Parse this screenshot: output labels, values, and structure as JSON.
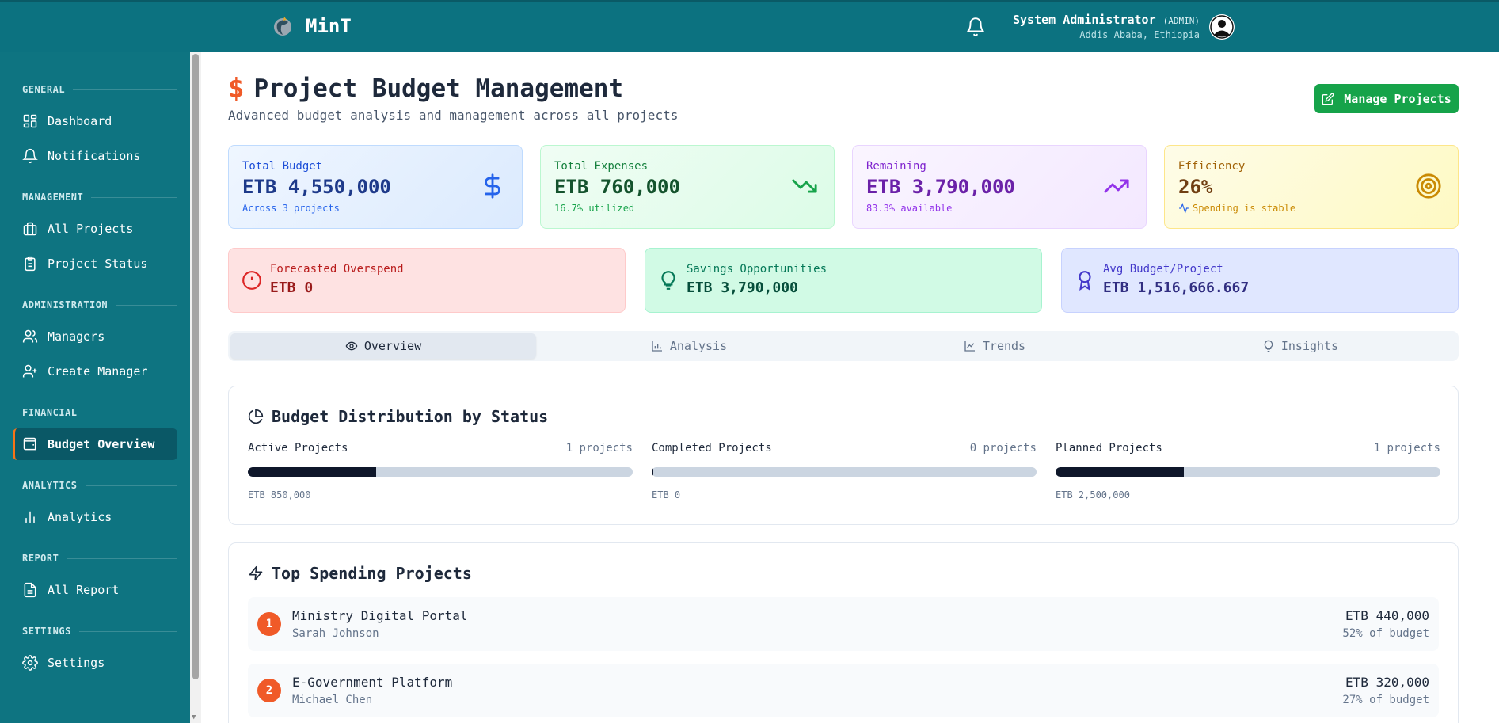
{
  "app": {
    "name": "MinT"
  },
  "header": {
    "user_name": "System Administrator",
    "user_role": "(ADMIN)",
    "user_location": "Addis Ababa, Ethiopia"
  },
  "sidebar": {
    "sections": [
      {
        "title": "GENERAL",
        "items": [
          {
            "label": "Dashboard",
            "icon": "dashboard-icon"
          },
          {
            "label": "Notifications",
            "icon": "bell-icon"
          }
        ]
      },
      {
        "title": "MANAGEMENT",
        "items": [
          {
            "label": "All Projects",
            "icon": "briefcase-icon"
          },
          {
            "label": "Project Status",
            "icon": "clipboard-icon"
          }
        ]
      },
      {
        "title": "ADMINISTRATION",
        "items": [
          {
            "label": "Managers",
            "icon": "users-icon"
          },
          {
            "label": "Create Manager",
            "icon": "user-plus-icon"
          }
        ]
      },
      {
        "title": "FINANCIAL",
        "items": [
          {
            "label": "Budget Overview",
            "icon": "wallet-icon",
            "active": true
          }
        ]
      },
      {
        "title": "ANALYTICS",
        "items": [
          {
            "label": "Analytics",
            "icon": "bar-chart-icon"
          }
        ]
      },
      {
        "title": "REPORT",
        "items": [
          {
            "label": "All Report",
            "icon": "file-icon"
          }
        ]
      },
      {
        "title": "SETTINGS",
        "items": [
          {
            "label": "Settings",
            "icon": "gear-icon"
          }
        ]
      }
    ]
  },
  "page": {
    "title": "Project Budget Management",
    "subtitle": "Advanced budget analysis and management across all projects",
    "manage_button": "Manage Projects"
  },
  "stats": [
    {
      "label": "Total Budget",
      "value": "ETB 4,550,000",
      "sub": "Across 3 projects",
      "icon": "dollar-icon",
      "color": "#1d4ed8"
    },
    {
      "label": "Total Expenses",
      "value": "ETB 760,000",
      "sub": "16.7% utilized",
      "icon": "trending-down-icon",
      "color": "#15803d"
    },
    {
      "label": "Remaining",
      "value": "ETB 3,790,000",
      "sub": "83.3% available",
      "icon": "trending-up-icon",
      "color": "#7e22ce"
    },
    {
      "label": "Efficiency",
      "value": "26%",
      "sub": "Spending is stable",
      "icon": "target-icon",
      "color": "#a16207"
    }
  ],
  "stats2": [
    {
      "label": "Forecasted Overspend",
      "value": "ETB 0",
      "icon": "alert-circle-icon",
      "color": "#dc2626"
    },
    {
      "label": "Savings Opportunities",
      "value": "ETB 3,790,000",
      "icon": "lightbulb-icon",
      "color": "#047857"
    },
    {
      "label": "Avg Budget/Project",
      "value": "ETB 1,516,666.667",
      "icon": "award-icon",
      "color": "#4338ca"
    }
  ],
  "tabs": [
    {
      "label": "Overview",
      "icon": "eye-icon",
      "active": true
    },
    {
      "label": "Analysis",
      "icon": "bar-chart-icon"
    },
    {
      "label": "Trends",
      "icon": "line-chart-icon"
    },
    {
      "label": "Insights",
      "icon": "lightbulb-icon"
    }
  ],
  "distribution": {
    "title": "Budget Distribution by Status",
    "items": [
      {
        "name": "Active Projects",
        "count": "1 projects",
        "amount": "ETB 850,000",
        "fraction": 0.333
      },
      {
        "name": "Completed Projects",
        "count": "0 projects",
        "amount": "ETB 0",
        "fraction": 0.0
      },
      {
        "name": "Planned Projects",
        "count": "1 projects",
        "amount": "ETB 2,500,000",
        "fraction": 0.333
      }
    ]
  },
  "top_spending": {
    "title": "Top Spending Projects",
    "items": [
      {
        "rank": "1",
        "name": "Ministry Digital Portal",
        "manager": "Sarah Johnson",
        "amount": "ETB 440,000",
        "pct": "52% of budget"
      },
      {
        "rank": "2",
        "name": "E-Government Platform",
        "manager": "Michael Chen",
        "amount": "ETB 320,000",
        "pct": "27% of budget"
      }
    ]
  }
}
